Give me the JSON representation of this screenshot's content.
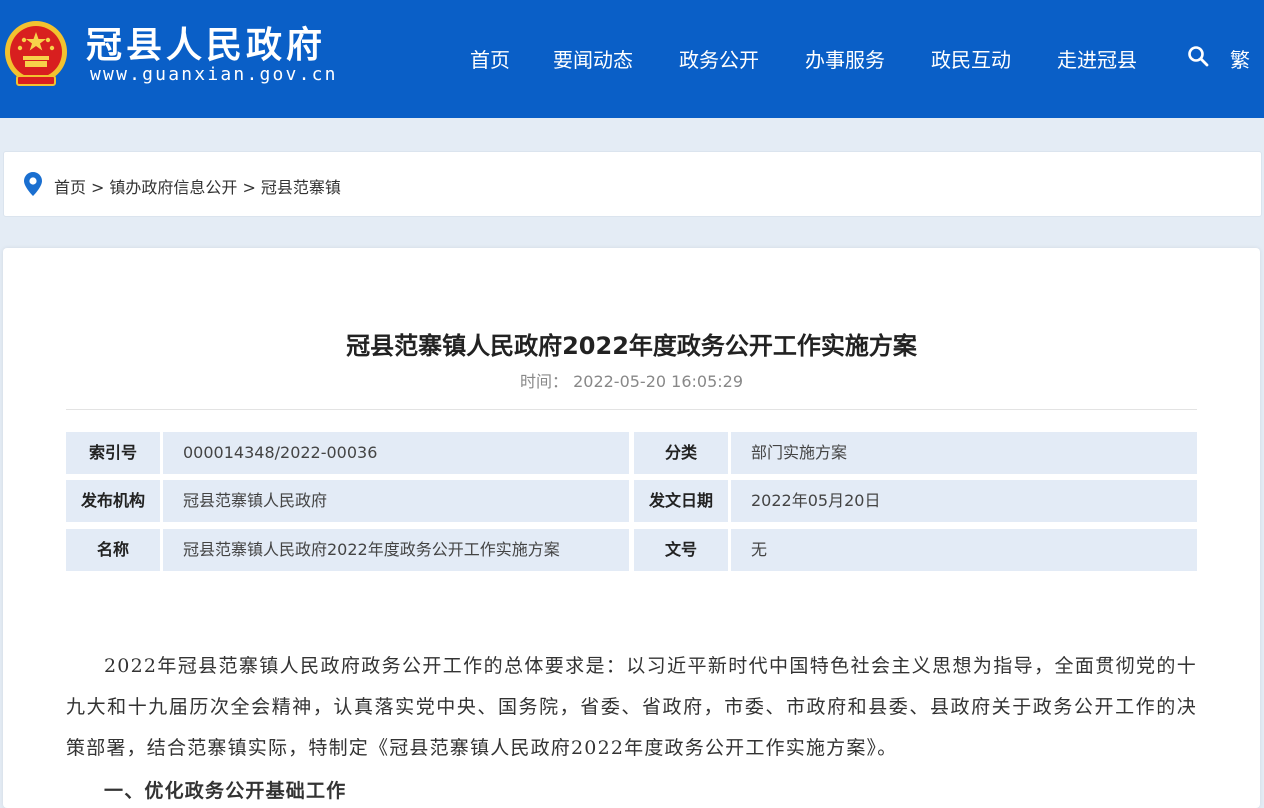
{
  "header": {
    "site_title": "冠县人民政府",
    "site_url": "www.guanxian.gov.cn",
    "brand_color": "#0a5fc7",
    "nav": [
      "首页",
      "要闻动态",
      "政务公开",
      "办事服务",
      "政民互动",
      "走进冠县"
    ],
    "traditional_label": "繁",
    "icons": [
      "national-emblem-icon",
      "search-icon"
    ]
  },
  "breadcrumb": {
    "icon": "location-pin-icon",
    "items": [
      "首页",
      "镇办政府信息公开",
      "冠县范寨镇"
    ],
    "separator": ">"
  },
  "article": {
    "title": "冠县范寨镇人民政府2022年度政务公开工作实施方案",
    "time_label": "时间：",
    "time_value": "2022-05-20 16:05:29",
    "meta": [
      {
        "key": "索引号",
        "value": "000014348/2022-00036",
        "key2": "分类",
        "value2": "部门实施方案"
      },
      {
        "key": "发布机构",
        "value": "冠县范寨镇人民政府",
        "key2": "发文日期",
        "value2": "2022年05月20日"
      },
      {
        "key": "名称",
        "value": "冠县范寨镇人民政府2022年度政务公开工作实施方案",
        "key2": "文号",
        "value2": "无"
      }
    ],
    "body": "2022年冠县范寨镇人民政府政务公开工作的总体要求是：以习近平新时代中国特色社会主义思想为指导，全面贯彻党的十九大和十九届历次全会精神，认真落实党中央、国务院，省委、省政府，市委、市政府和县委、县政府关于政务公开工作的决策部署，结合范寨镇实际，特制定《冠县范寨镇人民政府2022年度政务公开工作实施方案》。",
    "sub_heading": "一、优化政务公开基础工作"
  }
}
